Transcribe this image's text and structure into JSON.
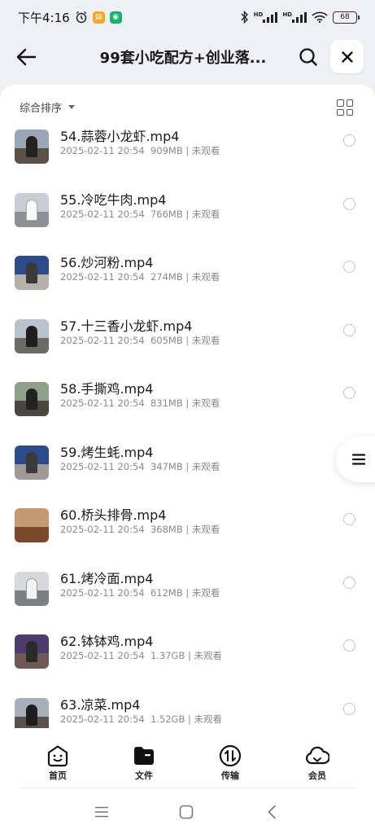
{
  "status_bar": {
    "time": "下午4:16",
    "hd1": "HD",
    "hd2": "HD",
    "battery": "68"
  },
  "nav": {
    "title": "99套小吃配方+创业落..."
  },
  "toolbar": {
    "sort_label": "综合排序"
  },
  "files": [
    {
      "name": "54.蒜蓉小龙虾.mp4",
      "date": "2025-02-11 20:54",
      "size": "909MB",
      "status": "未观看"
    },
    {
      "name": "55.冷吃牛肉.mp4",
      "date": "2025-02-11 20:54",
      "size": "766MB",
      "status": "未观看"
    },
    {
      "name": "56.炒河粉.mp4",
      "date": "2025-02-11 20:54",
      "size": "274MB",
      "status": "未观看"
    },
    {
      "name": "57.十三香小龙虾.mp4",
      "date": "2025-02-11 20:54",
      "size": "605MB",
      "status": "未观看"
    },
    {
      "name": "58.手撕鸡.mp4",
      "date": "2025-02-11 20:54",
      "size": "831MB",
      "status": "未观看"
    },
    {
      "name": "59.烤生蚝.mp4",
      "date": "2025-02-11 20:54",
      "size": "347MB",
      "status": "未观看"
    },
    {
      "name": "60.桥头排骨.mp4",
      "date": "2025-02-11 20:54",
      "size": "368MB",
      "status": "未观看"
    },
    {
      "name": "61.烤冷面.mp4",
      "date": "2025-02-11 20:54",
      "size": "612MB",
      "status": "未观看"
    },
    {
      "name": "62.钵钵鸡.mp4",
      "date": "2025-02-11 20:54",
      "size": "1.37GB",
      "status": "未观看"
    },
    {
      "name": "63.凉菜.mp4",
      "date": "2025-02-11 20:54",
      "size": "1.52GB",
      "status": "未观看"
    }
  ],
  "tabs": [
    {
      "label": "首页",
      "icon": "home-smile-icon"
    },
    {
      "label": "文件",
      "icon": "folder-icon"
    },
    {
      "label": "传输",
      "icon": "transfer-icon"
    },
    {
      "label": "会员",
      "icon": "cloud-icon"
    }
  ],
  "colors": {
    "background": "#eef0f4",
    "sheet": "#ffffff",
    "text_primary": "#1a1a1a",
    "text_secondary": "#8a8a8a"
  }
}
